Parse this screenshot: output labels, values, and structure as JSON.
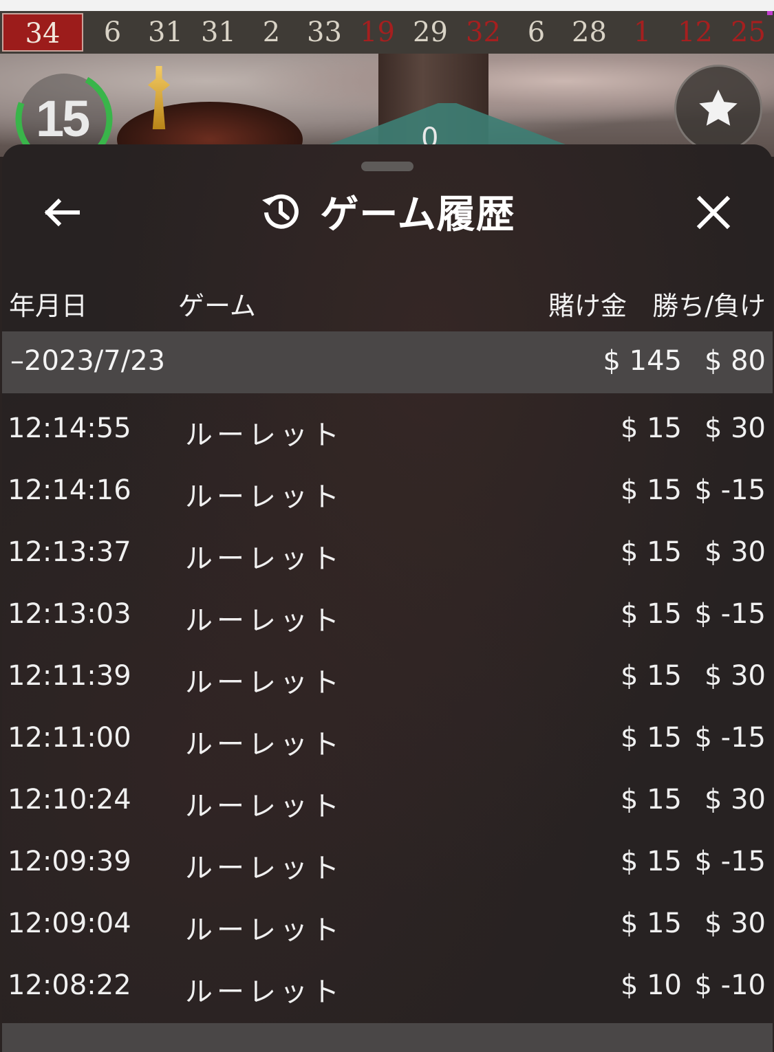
{
  "results_bar": {
    "numbers": [
      {
        "value": "34",
        "color": "red"
      },
      {
        "value": "6",
        "color": "black"
      },
      {
        "value": "31",
        "color": "black"
      },
      {
        "value": "31",
        "color": "black"
      },
      {
        "value": "2",
        "color": "black"
      },
      {
        "value": "33",
        "color": "black"
      },
      {
        "value": "19",
        "color": "red"
      },
      {
        "value": "29",
        "color": "black"
      },
      {
        "value": "32",
        "color": "red"
      },
      {
        "value": "6",
        "color": "black"
      },
      {
        "value": "28",
        "color": "black"
      },
      {
        "value": "1",
        "color": "red"
      },
      {
        "value": "12",
        "color": "red"
      },
      {
        "value": "25",
        "color": "red"
      }
    ]
  },
  "video": {
    "countdown": "15",
    "countdown_ring_color": "#39b54a",
    "felt_number": "0"
  },
  "panel": {
    "title": "ゲーム履歴",
    "back_icon": "arrow-left-icon",
    "close_icon": "close-icon",
    "history_icon": "history-icon",
    "favorite_icon": "star-icon"
  },
  "columns": {
    "date": "年月日",
    "game": "ゲーム",
    "stake": "賭け金",
    "winloss": "勝ち/負け"
  },
  "day_group": {
    "date": "–2023/7/23",
    "stake": "$ 145",
    "winloss": "$ 80"
  },
  "rows": [
    {
      "time": "12:14:55",
      "game": "ルーレット",
      "stake": "$ 15",
      "winloss": "$ 30"
    },
    {
      "time": "12:14:16",
      "game": "ルーレット",
      "stake": "$ 15",
      "winloss": "$ -15"
    },
    {
      "time": "12:13:37",
      "game": "ルーレット",
      "stake": "$ 15",
      "winloss": "$ 30"
    },
    {
      "time": "12:13:03",
      "game": "ルーレット",
      "stake": "$ 15",
      "winloss": "$ -15"
    },
    {
      "time": "12:11:39",
      "game": "ルーレット",
      "stake": "$ 15",
      "winloss": "$ 30"
    },
    {
      "time": "12:11:00",
      "game": "ルーレット",
      "stake": "$ 15",
      "winloss": "$ -15"
    },
    {
      "time": "12:10:24",
      "game": "ルーレット",
      "stake": "$ 15",
      "winloss": "$ 30"
    },
    {
      "time": "12:09:39",
      "game": "ルーレット",
      "stake": "$ 15",
      "winloss": "$ -15"
    },
    {
      "time": "12:09:04",
      "game": "ルーレット",
      "stake": "$ 15",
      "winloss": "$ 30"
    },
    {
      "time": "12:08:22",
      "game": "ルーレット",
      "stake": "$ 10",
      "winloss": "$ -10"
    }
  ]
}
